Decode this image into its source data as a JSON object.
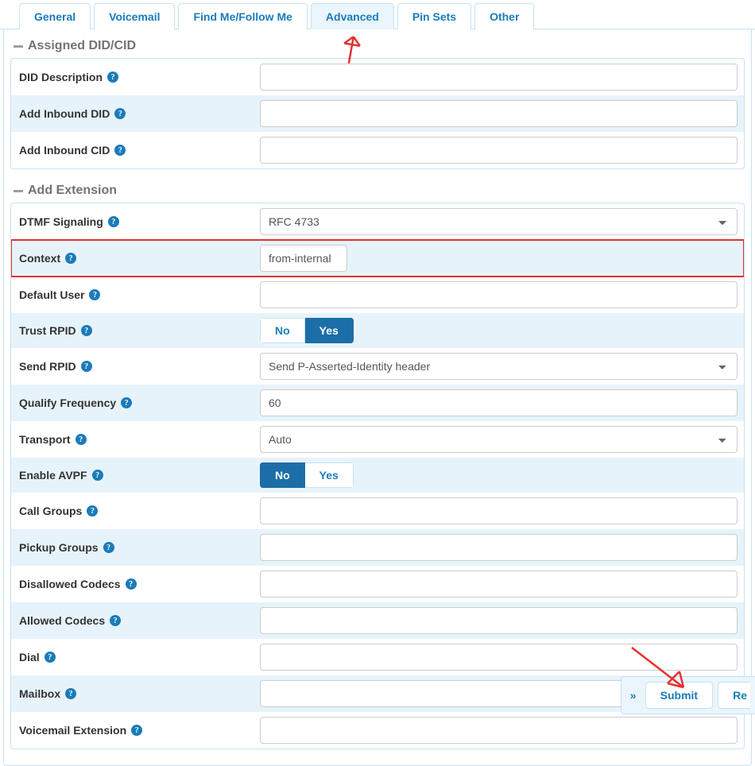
{
  "tabs": [
    "General",
    "Voicemail",
    "Find Me/Follow Me",
    "Advanced",
    "Pin Sets",
    "Other"
  ],
  "activeTab": "Advanced",
  "sections": {
    "assigned": {
      "title": "Assigned DID/CID",
      "rows": {
        "did_desc": {
          "label": "DID Description",
          "value": ""
        },
        "add_did": {
          "label": "Add Inbound DID",
          "value": ""
        },
        "add_cid": {
          "label": "Add Inbound CID",
          "value": ""
        }
      }
    },
    "add_ext": {
      "title": "Add Extension",
      "rows": {
        "dtmf": {
          "label": "DTMF Signaling",
          "value": "RFC 4733"
        },
        "context": {
          "label": "Context",
          "value": "from-internal"
        },
        "def_user": {
          "label": "Default User",
          "value": ""
        },
        "trust_rpid": {
          "label": "Trust RPID",
          "no": "No",
          "yes": "Yes",
          "selected": "Yes"
        },
        "send_rpid": {
          "label": "Send RPID",
          "value": "Send P-Asserted-Identity header"
        },
        "qualify": {
          "label": "Qualify Frequency",
          "value": "60"
        },
        "transport": {
          "label": "Transport",
          "value": "Auto"
        },
        "avpf": {
          "label": "Enable AVPF",
          "no": "No",
          "yes": "Yes",
          "selected": "No"
        },
        "callgrp": {
          "label": "Call Groups",
          "value": ""
        },
        "pickgrp": {
          "label": "Pickup Groups",
          "value": ""
        },
        "disallow": {
          "label": "Disallowed Codecs",
          "value": ""
        },
        "allow": {
          "label": "Allowed Codecs",
          "value": ""
        },
        "dial": {
          "label": "Dial",
          "value": ""
        },
        "mailbox": {
          "label": "Mailbox",
          "value": ""
        },
        "vmext": {
          "label": "Voicemail Extension",
          "value": ""
        }
      }
    }
  },
  "footer": {
    "submit": "Submit",
    "reset_partial": "Re"
  }
}
